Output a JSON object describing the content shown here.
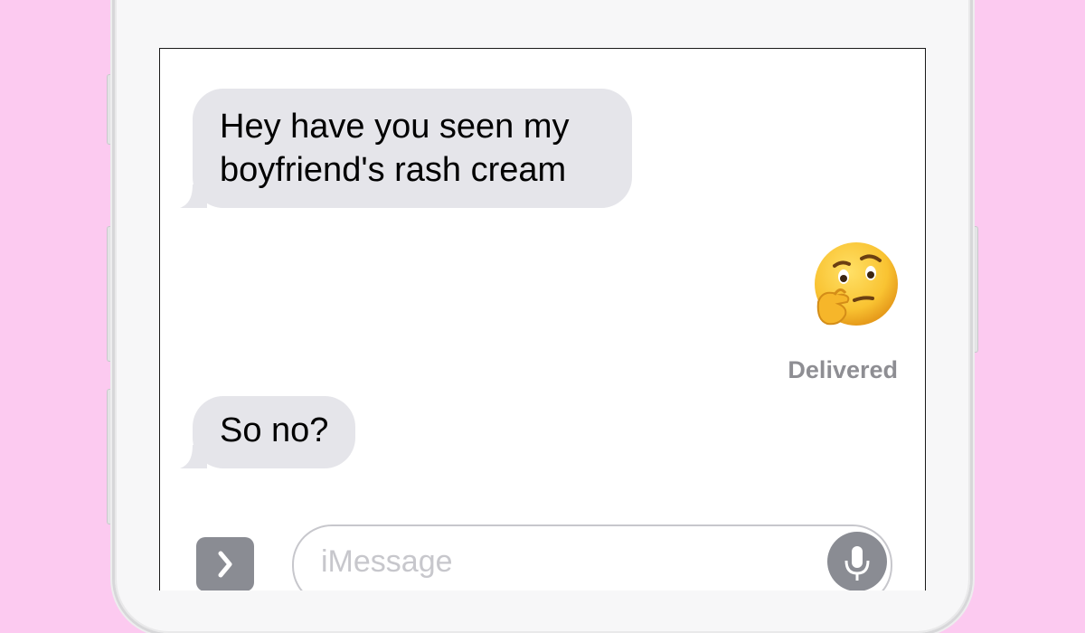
{
  "messages": [
    {
      "sender": "other",
      "text": "Hey have you seen my boyfriend's rash cream"
    },
    {
      "sender": "me",
      "emoji": "thinking-face",
      "status": "Delivered"
    },
    {
      "sender": "other",
      "text": "So no?"
    }
  ],
  "composer": {
    "placeholder": "iMessage",
    "app_button_icon": "chevron-right-icon",
    "mic_icon": "microphone-icon"
  },
  "colors": {
    "background": "#fccaf0",
    "incoming_bubble": "#e5e5ea",
    "status_text": "#8e8e93",
    "control_gray": "#8a8c93"
  }
}
